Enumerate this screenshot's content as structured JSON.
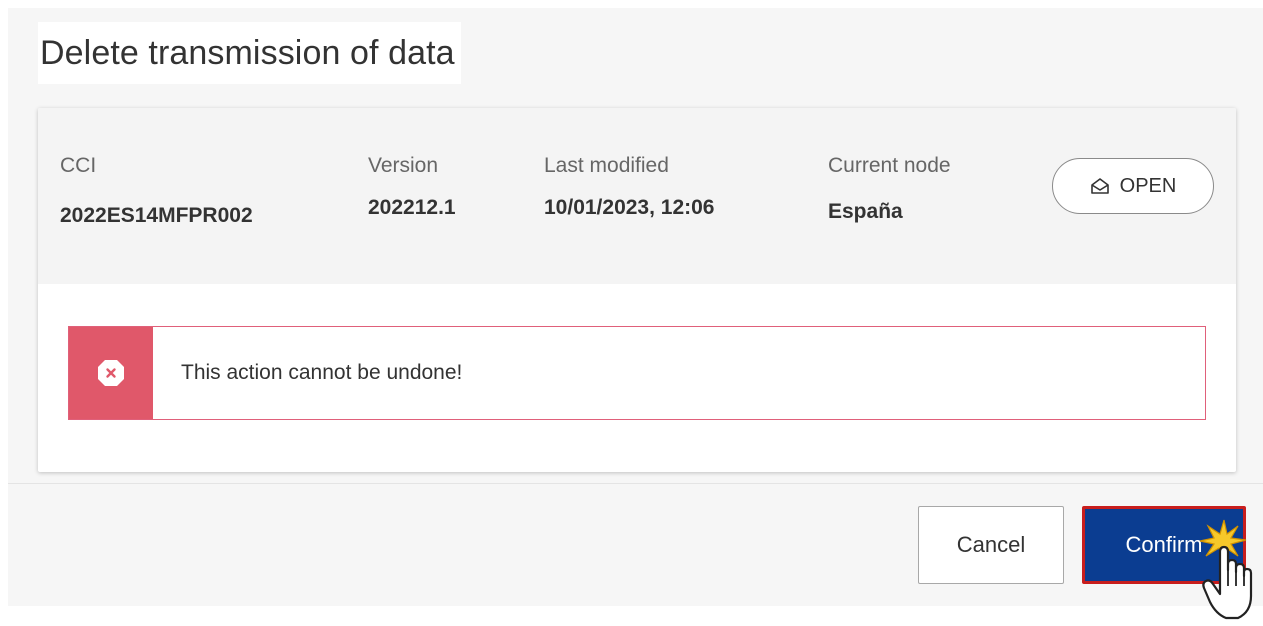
{
  "dialog": {
    "title": "Delete transmission of data"
  },
  "header": {
    "cci": {
      "label": "CCI",
      "value": "2022ES14MFPR002"
    },
    "version": {
      "label": "Version",
      "value": "202212.1"
    },
    "last_modified": {
      "label": "Last modified",
      "value": "10/01/2023, 12:06"
    },
    "current_node": {
      "label": "Current node",
      "value": "España"
    },
    "status_button": {
      "label": "OPEN",
      "icon": "open-envelope-icon"
    }
  },
  "alert": {
    "icon": "error-x-icon",
    "message": "This action cannot be undone!",
    "color": "#e0586a"
  },
  "footer": {
    "cancel_label": "Cancel",
    "confirm_label": "Confirm"
  },
  "colors": {
    "primary": "#0b3d91",
    "highlight": "#c81e1e"
  }
}
